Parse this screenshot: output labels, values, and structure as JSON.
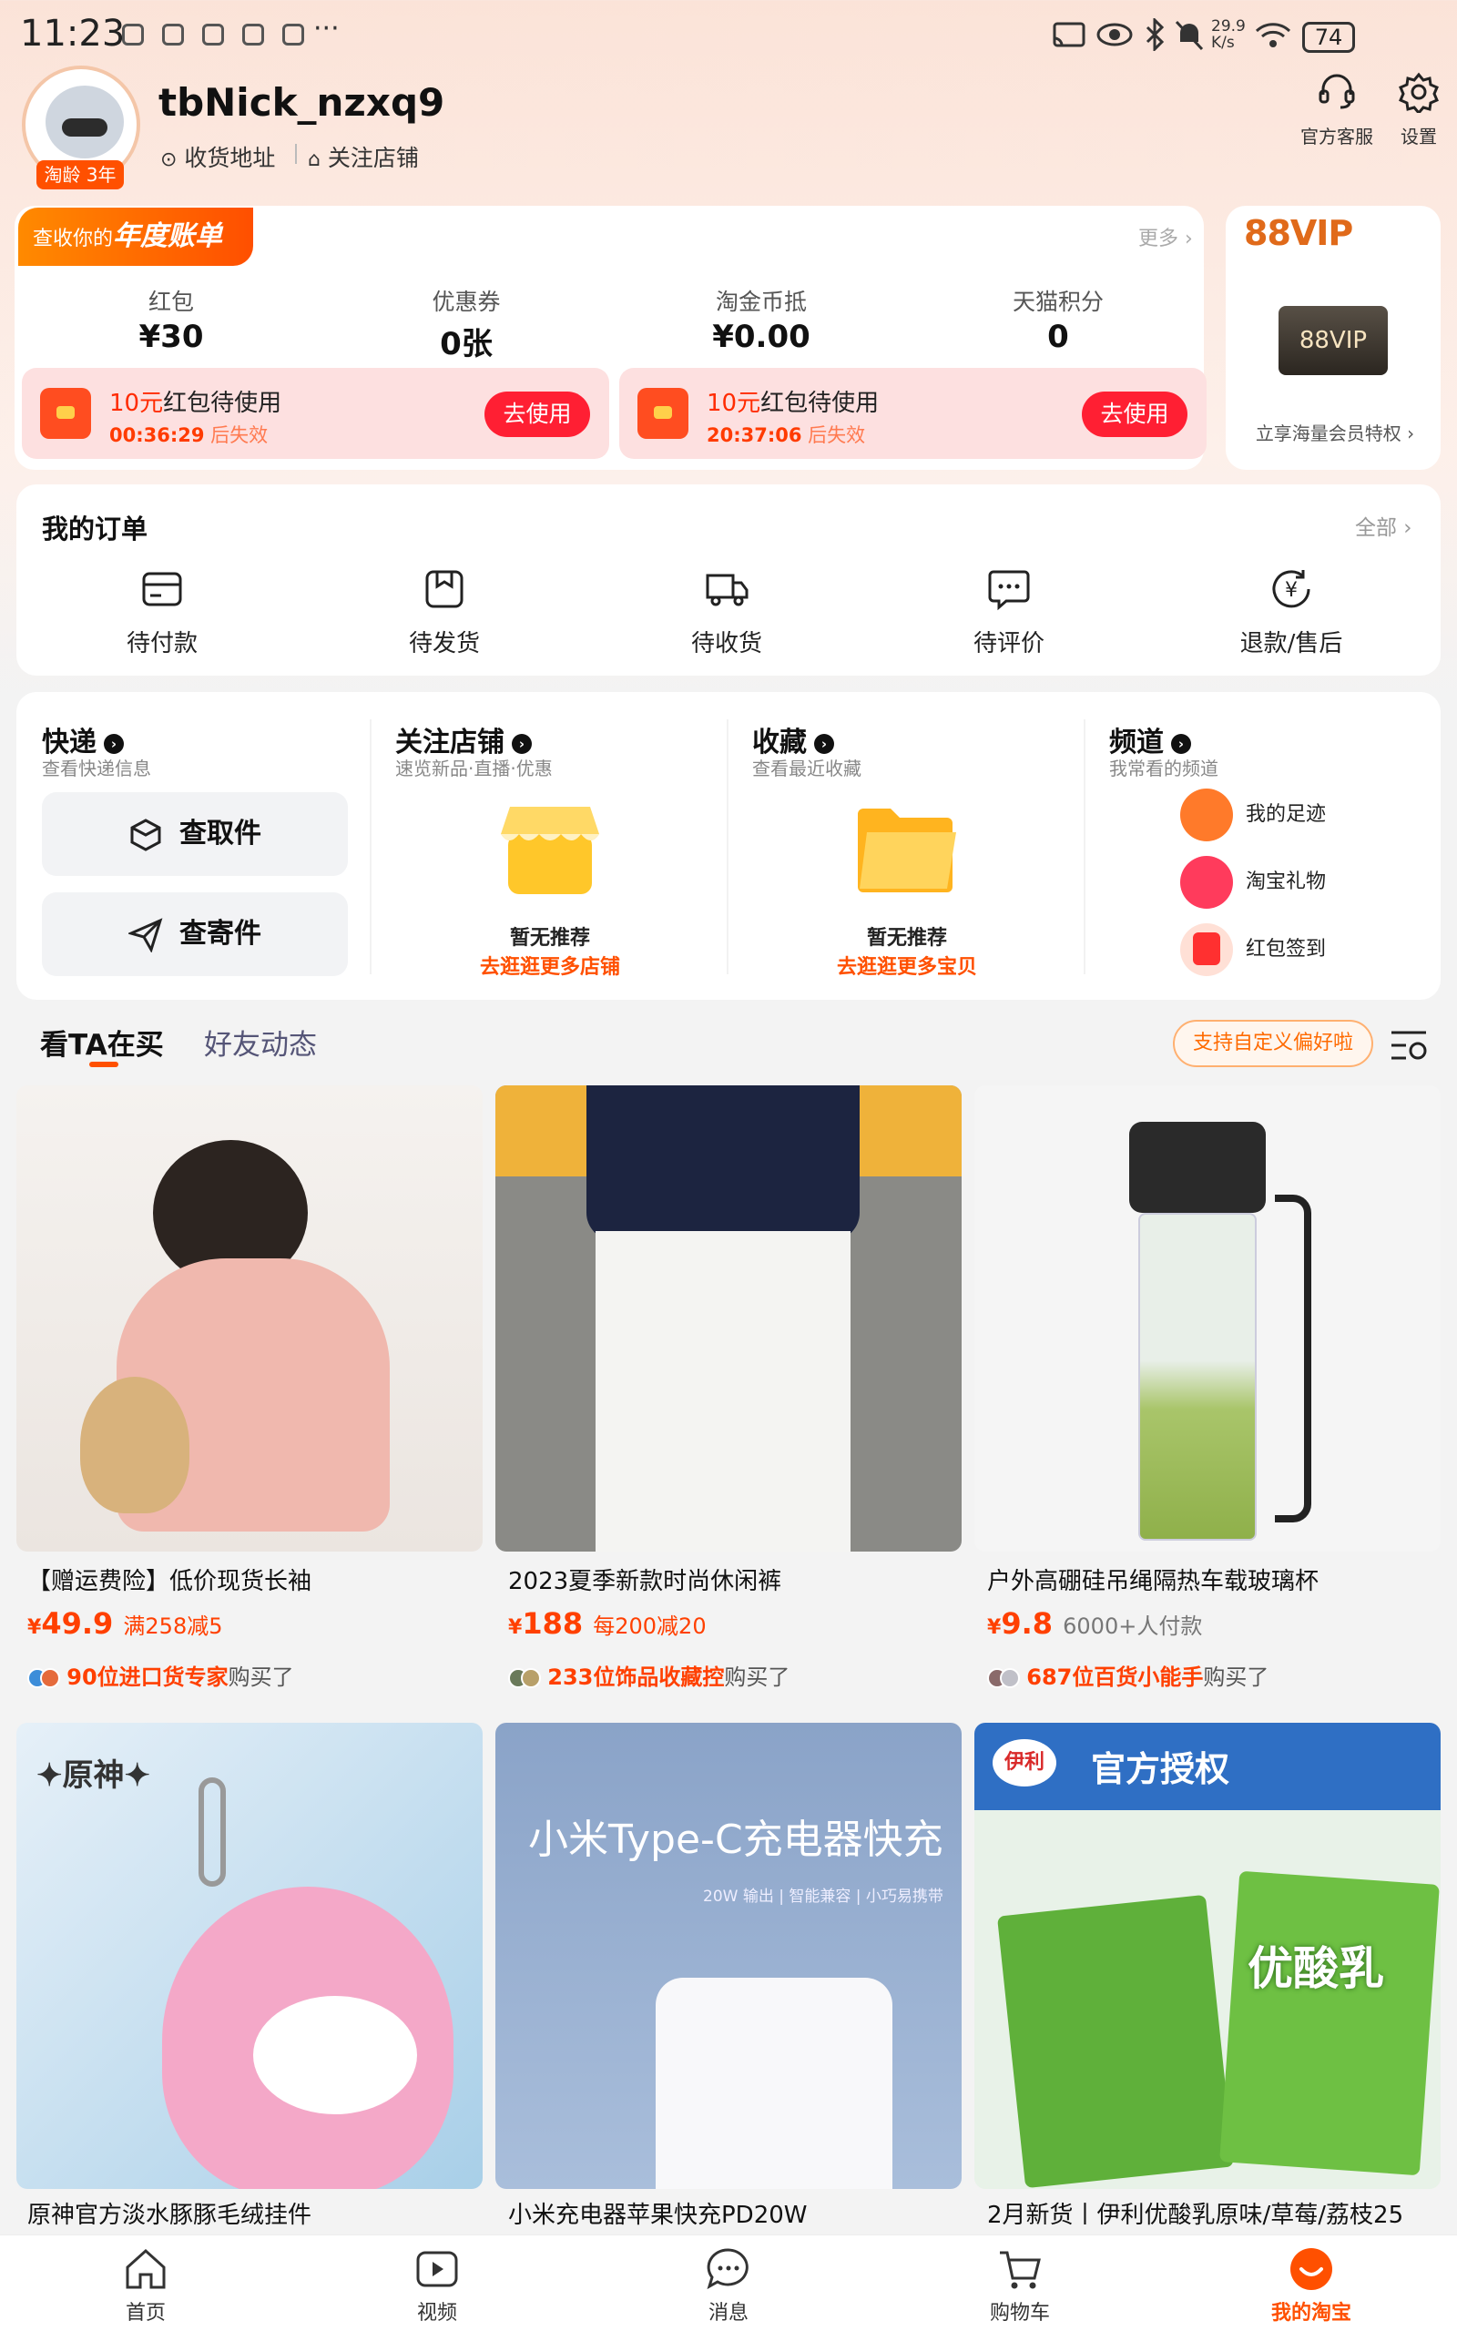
{
  "status_bar": {
    "time": "11:23",
    "overflow": "···",
    "net_speed": "29.9\nK/s",
    "battery": "74"
  },
  "profile": {
    "username": "tbNick_nzxq9",
    "age_badge": "淘龄 3年",
    "address_link": "收货地址",
    "follow_shops_link": "关注店铺",
    "customer_service_label": "官方客服",
    "settings_label": "设置"
  },
  "assets": {
    "annual_bill_prefix": "查收你的",
    "annual_bill_title": "年度账单",
    "more_label": "更多 ›",
    "stats": [
      {
        "label": "红包",
        "value": "¥30"
      },
      {
        "label": "优惠券",
        "value": "0张"
      },
      {
        "label": "淘金币抵",
        "value": "¥0.00"
      },
      {
        "label": "天猫积分",
        "value": "0"
      }
    ],
    "coupons": [
      {
        "title_amount": "10元",
        "title_rest": "红包待使用",
        "countdown": "00:36:29",
        "expire_suffix": "后失效",
        "button": "去使用"
      },
      {
        "title_amount": "10元",
        "title_rest": "红包待使用",
        "countdown": "20:37:06",
        "expire_suffix": "后失效",
        "button": "去使用"
      }
    ]
  },
  "vip": {
    "title": "88VIP",
    "card_label": "88VIP",
    "subtitle": "立享海量会员特权 ›"
  },
  "orders": {
    "title": "我的订单",
    "all_label": "全部 ›",
    "items": [
      {
        "label": "待付款",
        "icon": "wallet-icon"
      },
      {
        "label": "待发货",
        "icon": "box-icon"
      },
      {
        "label": "待收货",
        "icon": "truck-icon"
      },
      {
        "label": "待评价",
        "icon": "comment-icon"
      },
      {
        "label": "退款/售后",
        "icon": "refund-icon"
      }
    ]
  },
  "shortcuts": {
    "express": {
      "title": "快递",
      "subtitle": "查看快递信息",
      "pickup": "查取件",
      "send": "查寄件"
    },
    "shops": {
      "title": "关注店铺",
      "subtitle": "速览新品·直播·优惠",
      "empty": "暂无推荐",
      "link": "去逛逛更多店铺"
    },
    "favorites": {
      "title": "收藏",
      "subtitle": "查看最近收藏",
      "empty": "暂无推荐",
      "link": "去逛逛更多宝贝"
    },
    "channels": {
      "title": "频道",
      "subtitle": "我常看的频道",
      "items": [
        {
          "label": "我的足迹",
          "color": "#ff7a2a"
        },
        {
          "label": "淘宝礼物",
          "color": "#ff3b5c"
        },
        {
          "label": "红包签到",
          "color": "#ff3030"
        }
      ]
    }
  },
  "feed": {
    "tab_active": "看TA在买",
    "tab_other": "好友动态",
    "pref_button": "支持自定义偏好啦",
    "products": [
      {
        "title": "【赠运费险】低价现货长袖",
        "price": "49.9",
        "promo": "满258减5",
        "buyers_count": "90位进口货专家",
        "buyers_suffix": "购买了"
      },
      {
        "title": "2023夏季新款时尚休闲裤",
        "price": "188",
        "promo": "每200减20",
        "buyers_count": "233位饰品收藏控",
        "buyers_suffix": "购买了"
      },
      {
        "title": "户外高硼硅吊绳隔热车载玻璃杯",
        "price": "9.8",
        "promo": "6000+人付款",
        "buyers_count": "687位百货小能手",
        "buyers_suffix": "购买了"
      },
      {
        "title": "原神官方淡水豚豚毛绒挂件",
        "image_text": "✦原神✦"
      },
      {
        "title": "小米充电器苹果快充PD20W",
        "image_text": "小米Type-C充电器快充",
        "image_subtext": "20W 输出 | 智能兼容 | 小巧易携带"
      },
      {
        "title": "2月新货丨伊利优酸乳原味/草莓/荔枝25",
        "image_text": "官方授权",
        "brand": "伊利",
        "image_product": "优酸乳"
      }
    ]
  },
  "bottom_nav": [
    {
      "label": "首页",
      "icon": "home-icon"
    },
    {
      "label": "视频",
      "icon": "video-icon"
    },
    {
      "label": "消息",
      "icon": "message-icon"
    },
    {
      "label": "购物车",
      "icon": "cart-icon"
    },
    {
      "label": "我的淘宝",
      "icon": "taobao-icon",
      "active": true
    }
  ],
  "colors": {
    "accent": "#ff5000",
    "price_red": "#ff4000"
  }
}
